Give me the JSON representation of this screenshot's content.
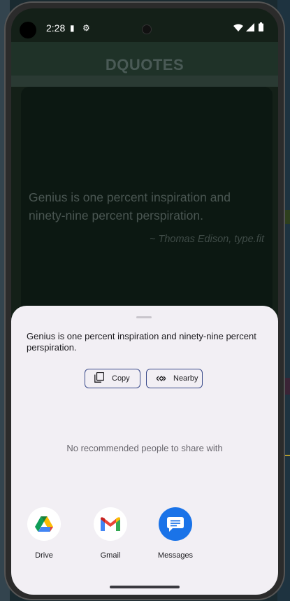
{
  "status": {
    "time": "2:28"
  },
  "app": {
    "title": "DQUOTES"
  },
  "quote": {
    "text": "Genius is one percent inspiration and ninety-nine percent perspiration.",
    "author": "~ Thomas Edison, type.fit"
  },
  "share_sheet": {
    "shared_text": "Genius is one percent inspiration and ninety-nine percent perspiration.",
    "chips": {
      "copy": "Copy",
      "nearby": "Nearby"
    },
    "no_recommendations": "No recommended people to share with",
    "targets": [
      {
        "label": "Drive",
        "icon": "google-drive-icon"
      },
      {
        "label": "Gmail",
        "icon": "gmail-icon"
      },
      {
        "label": "Messages",
        "icon": "messages-icon"
      }
    ]
  },
  "colors": {
    "sheet_bg": "#f2eff4",
    "chip_border": "#3a4a8a",
    "messages_blue": "#1a73e8",
    "scrim_screen": "#142018"
  }
}
